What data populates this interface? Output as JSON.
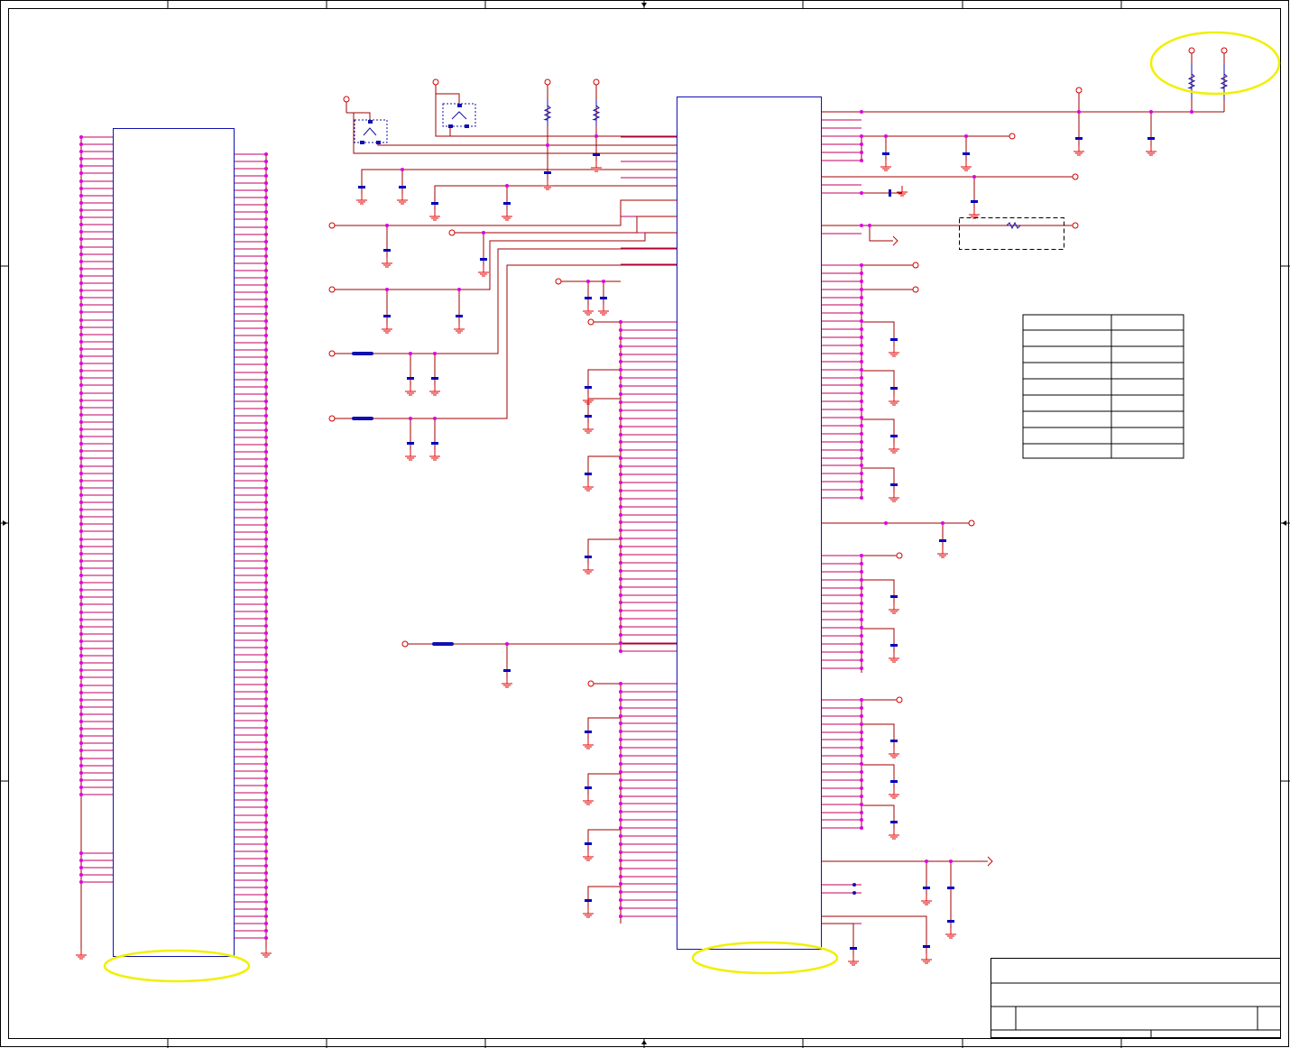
{
  "sheet": {
    "title_block_text": "",
    "notes_table": {
      "rows": [
        [
          "",
          ""
        ],
        [
          "",
          ""
        ],
        [
          "",
          ""
        ],
        [
          "",
          ""
        ],
        [
          "",
          ""
        ],
        [
          "",
          ""
        ],
        [
          "",
          ""
        ],
        [
          "",
          ""
        ],
        [
          "",
          ""
        ]
      ]
    }
  },
  "colors": {
    "wire": "#a00000",
    "pin": "#c00060",
    "junction": "#e000e0",
    "symbol": "#1010b0",
    "capacitor": "#0000c0",
    "ground": "#e00000",
    "net_port": "#d00000",
    "highlight": "#f0f000",
    "frame": "#000000"
  },
  "icons": {
    "connector": "connector-symbol",
    "ic": "ic-symbol",
    "transistor": "transistor-icon",
    "resistor": "resistor-icon",
    "capacitor": "capacitor-icon",
    "ground": "ground-icon",
    "ferrite": "ferrite-bead-icon",
    "port": "net-port-icon",
    "highlight": "highlight-ellipse"
  }
}
